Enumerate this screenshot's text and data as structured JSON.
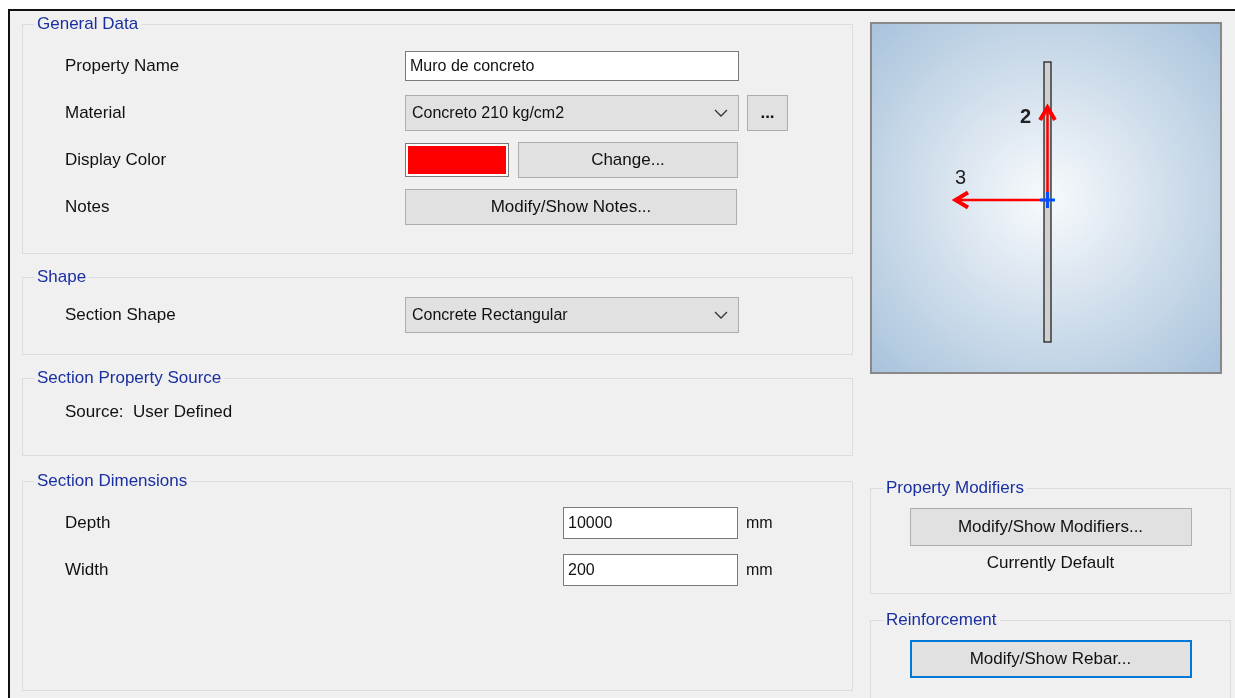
{
  "general_data": {
    "title": "General Data",
    "rows": [
      {
        "kind": "text",
        "label": "Property Name",
        "value": "Muro de concreto"
      },
      {
        "kind": "dropdown",
        "label": "Material",
        "value": "Concreto 210 kg/cm2",
        "button": "..."
      },
      {
        "kind": "color",
        "label": "Display Color",
        "color": "#ff0000",
        "button": "Change..."
      },
      {
        "kind": "button",
        "label": "Notes",
        "button": "Modify/Show Notes..."
      }
    ]
  },
  "shape": {
    "title": "Shape",
    "rows": [
      {
        "kind": "dropdown",
        "label": "Section Shape",
        "value": "Concrete Rectangular"
      }
    ]
  },
  "section_property_source": {
    "title": "Section Property Source",
    "text": "Source:  User Defined"
  },
  "section_dimensions": {
    "title": "Section Dimensions",
    "rows": [
      {
        "label": "Depth",
        "value": "10000",
        "unit": "mm"
      },
      {
        "label": "Width",
        "value": "200",
        "unit": "mm"
      }
    ]
  },
  "preview": {
    "axis_labels": [
      "2",
      "3"
    ]
  },
  "property_modifiers": {
    "title": "Property Modifiers",
    "button": "Modify/Show Modifiers...",
    "status": "Currently Default"
  },
  "reinforcement": {
    "title": "Reinforcement",
    "button": "Modify/Show Rebar...",
    "focused": true
  }
}
